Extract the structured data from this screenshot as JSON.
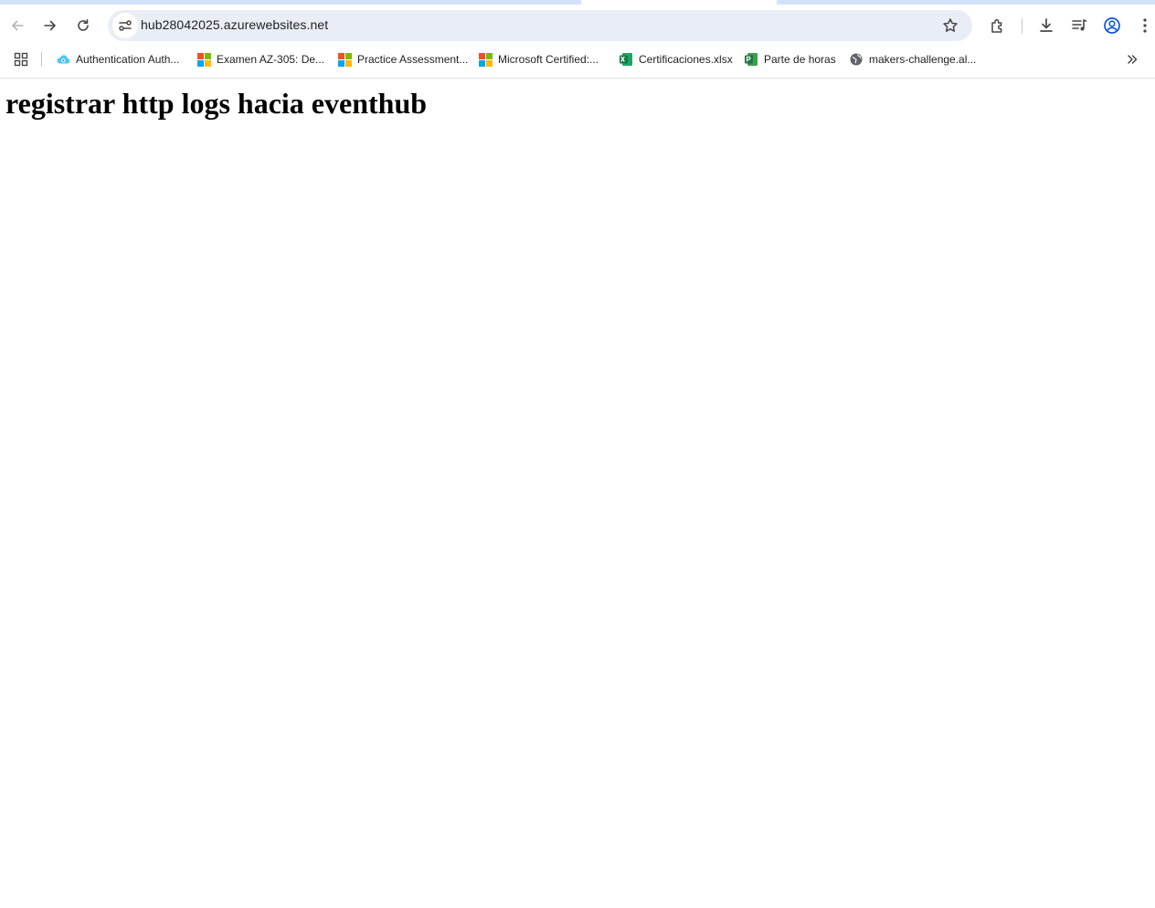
{
  "browser": {
    "address_bar": {
      "url": "hub28042025.azurewebsites.net"
    },
    "toolbar_icons": [
      "back-icon",
      "forward-icon",
      "reload-icon",
      "site-info-icon",
      "bookmark-star-icon",
      "extensions-icon",
      "downloads-icon",
      "media-control-icon",
      "profile-icon",
      "menu-icon"
    ],
    "bookmarks": [
      {
        "label": "Authentication Auth...",
        "icon": "azure-cloud-icon"
      },
      {
        "label": "Examen AZ-305: De...",
        "icon": "microsoft-logo-icon"
      },
      {
        "label": "Practice Assessment...",
        "icon": "microsoft-logo-icon"
      },
      {
        "label": "Microsoft Certified:...",
        "icon": "microsoft-logo-icon"
      },
      {
        "label": "Certificaciones.xlsx",
        "icon": "excel-icon"
      },
      {
        "label": "Parte de horas",
        "icon": "project-icon"
      },
      {
        "label": "makers-challenge.al...",
        "icon": "globe-icon"
      }
    ],
    "colors": {
      "tab_strip": "#d3e3fd",
      "omnibox": "#e9eef6",
      "icon": "#474747"
    }
  },
  "page": {
    "heading": "registrar http logs hacia eventhub"
  }
}
